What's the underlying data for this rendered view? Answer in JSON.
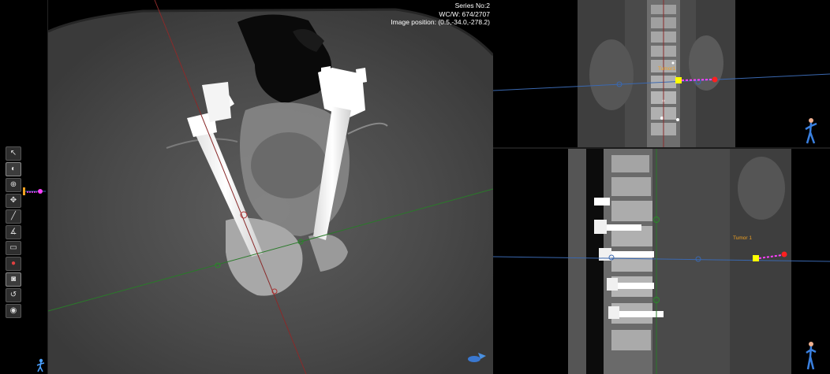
{
  "overlay": {
    "series": "Series No:2",
    "window": "WC/W: 674/2707",
    "image_position": "Image position: (0.5,-34.0,-278.2)"
  },
  "tools": [
    {
      "icon": "cursor-icon",
      "glyph": "↖"
    },
    {
      "icon": "contrast-icon",
      "glyph": "◐"
    },
    {
      "icon": "zoom-icon",
      "glyph": "⊕"
    },
    {
      "icon": "pan-icon",
      "glyph": "✥"
    },
    {
      "icon": "ruler-icon",
      "glyph": "╱"
    },
    {
      "icon": "angle-icon",
      "glyph": "∡"
    },
    {
      "icon": "measure-icon",
      "glyph": "▭"
    },
    {
      "icon": "color-lut-icon",
      "glyph": "●"
    },
    {
      "icon": "camera-icon",
      "glyph": "◙"
    },
    {
      "icon": "undo-icon",
      "glyph": "↺"
    },
    {
      "icon": "eye-icon",
      "glyph": "◉"
    }
  ],
  "annotations": {
    "coronal_tumor": "Tumor1",
    "sagittal_tumor": "Tumor 1"
  },
  "colors": {
    "axial_crosshair_red": "#8a2a2a",
    "axial_crosshair_green": "#2a7a2a",
    "reference_line_blue": "#3a68b0",
    "probe_magenta": "#ff40ff",
    "probe_tip_red": "#ff2020",
    "probe_base_yellow": "#ffff00",
    "annotation_orange": "#f0a020"
  }
}
